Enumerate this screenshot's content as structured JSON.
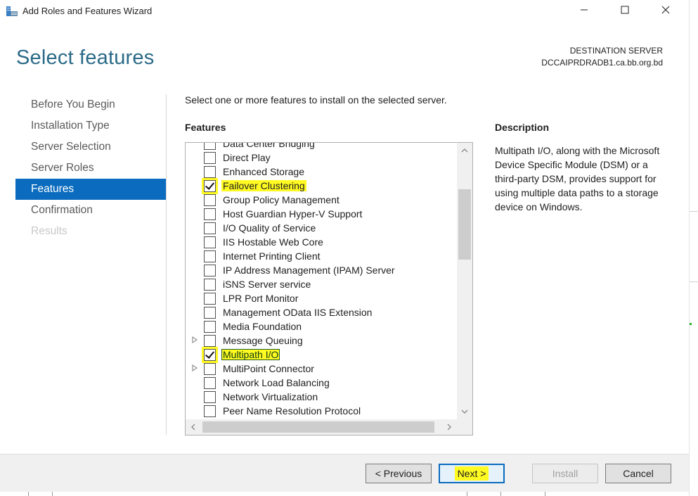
{
  "window": {
    "title": "Add Roles and Features Wizard",
    "minimize_icon": "minimize-icon",
    "maximize_icon": "maximize-icon",
    "close_icon": "close-icon"
  },
  "header": {
    "page_title": "Select features",
    "destination_label": "DESTINATION SERVER",
    "destination_server": "DCCAIPRDRADB1.ca.bb.org.bd"
  },
  "nav": {
    "items": [
      {
        "label": "Before You Begin",
        "state": "normal"
      },
      {
        "label": "Installation Type",
        "state": "normal"
      },
      {
        "label": "Server Selection",
        "state": "normal"
      },
      {
        "label": "Server Roles",
        "state": "normal"
      },
      {
        "label": "Features",
        "state": "active"
      },
      {
        "label": "Confirmation",
        "state": "normal"
      },
      {
        "label": "Results",
        "state": "disabled"
      }
    ]
  },
  "main": {
    "instruction": "Select one or more features to install on the selected server.",
    "features_heading": "Features",
    "features": [
      {
        "label": "Data Center Bridging",
        "checked": false,
        "expandable": false
      },
      {
        "label": "Direct Play",
        "checked": false,
        "expandable": false
      },
      {
        "label": "Enhanced Storage",
        "checked": false,
        "expandable": false
      },
      {
        "label": "Failover Clustering",
        "checked": true,
        "expandable": false,
        "highlighted": true
      },
      {
        "label": "Group Policy Management",
        "checked": false,
        "expandable": false
      },
      {
        "label": "Host Guardian Hyper-V Support",
        "checked": false,
        "expandable": false
      },
      {
        "label": "I/O Quality of Service",
        "checked": false,
        "expandable": false
      },
      {
        "label": "IIS Hostable Web Core",
        "checked": false,
        "expandable": false
      },
      {
        "label": "Internet Printing Client",
        "checked": false,
        "expandable": false
      },
      {
        "label": "IP Address Management (IPAM) Server",
        "checked": false,
        "expandable": false
      },
      {
        "label": "iSNS Server service",
        "checked": false,
        "expandable": false
      },
      {
        "label": "LPR Port Monitor",
        "checked": false,
        "expandable": false
      },
      {
        "label": "Management OData IIS Extension",
        "checked": false,
        "expandable": false
      },
      {
        "label": "Media Foundation",
        "checked": false,
        "expandable": false
      },
      {
        "label": "Message Queuing",
        "checked": false,
        "expandable": true
      },
      {
        "label": "Multipath I/O",
        "checked": true,
        "expandable": false,
        "highlighted": true,
        "selected": true
      },
      {
        "label": "MultiPoint Connector",
        "checked": false,
        "expandable": true
      },
      {
        "label": "Network Load Balancing",
        "checked": false,
        "expandable": false
      },
      {
        "label": "Network Virtualization",
        "checked": false,
        "expandable": false
      },
      {
        "label": "Peer Name Resolution Protocol",
        "checked": false,
        "expandable": false
      }
    ],
    "description_heading": "Description",
    "description_text": "Multipath I/O, along with the Microsoft Device Specific Module (DSM) or a third-party DSM, provides support for using multiple data paths to a storage device on Windows."
  },
  "footer": {
    "previous_label": "< Previous",
    "next_label": "Next >",
    "install_label": "Install",
    "cancel_label": "Cancel"
  },
  "colors": {
    "accent": "#0a6bbf",
    "title_color": "#2a6a88",
    "highlight": "#fffa21"
  }
}
